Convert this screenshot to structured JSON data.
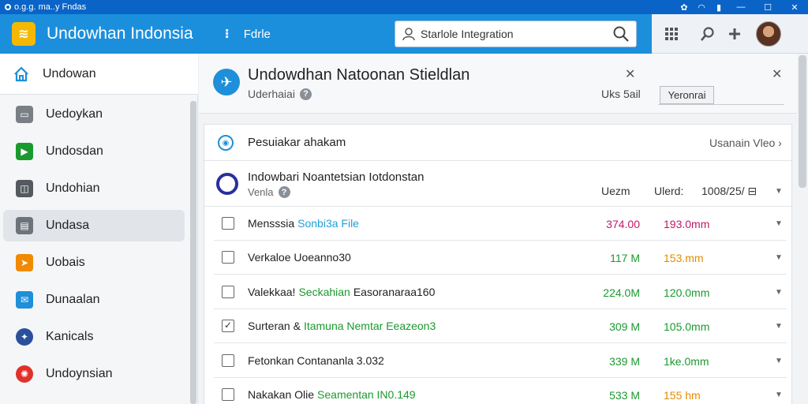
{
  "titlebar": {
    "title": "o.g.g. ma..y Fndas"
  },
  "header": {
    "app_title": "Undowhan Indonsia",
    "info_icon": "info-icon",
    "link": "Fdrle"
  },
  "search": {
    "value": "Starlole Integration"
  },
  "sidebar": {
    "items": [
      {
        "label": "Undowan",
        "icon": "home-icon"
      },
      {
        "label": "Uedoykan",
        "icon": "inbox-icon"
      },
      {
        "label": "Undosdan",
        "icon": "play-icon"
      },
      {
        "label": "Undohian",
        "icon": "folder-icon"
      },
      {
        "label": "Undasa",
        "icon": "window-icon"
      },
      {
        "label": "Uobais",
        "icon": "send-icon"
      },
      {
        "label": "Dunaalan",
        "icon": "mail-icon"
      },
      {
        "label": "Kanicals",
        "icon": "bird-icon"
      },
      {
        "label": "Undoynsian",
        "icon": "star-icon"
      }
    ]
  },
  "banner": {
    "title": "Undowdhan Natoonan Stieldlan",
    "subtitle": "Uderhaiai",
    "right_text": "Uks 5ail",
    "button": "Yeronrai"
  },
  "card": {
    "title": "Pesuiakar ahakam",
    "link": "Usanain Vleo ›",
    "group": {
      "title": "Indowbari Noantetsian Iotdonstan",
      "subtitle": "Venla",
      "col1": "Uezm",
      "col2": "Ulerd:",
      "col3": "1008/25/ ⊟"
    },
    "rows": [
      {
        "text": "Mensssia",
        "accent": "Sonbi3a File",
        "accent_color": "#1f9fd8",
        "value": "374.00",
        "value_color": "#c0186a",
        "value2": "193.0mm",
        "value2_color": "#c0186a",
        "checked": false
      },
      {
        "text": "Verkaloe Uoeanno30",
        "accent": "",
        "accent_color": "#222222",
        "value": "117 M",
        "value_color": "#1a9a2e",
        "value2": "153.mm",
        "value2_color": "#e58c00",
        "checked": false
      },
      {
        "text": "Valekkaa!",
        "accent": "Seckahian",
        "accent_color": "#1a9a2e",
        "tail": "Easoranaraa160",
        "value": "224.0M",
        "value_color": "#1a9a2e",
        "value2": "120.0mm",
        "value2_color": "#1a9a2e",
        "checked": false
      },
      {
        "text": "Surteran &",
        "accent": "Itamuna Nemtar Eeazeon3",
        "accent_color": "#1a9a2e",
        "value": "309 M",
        "value_color": "#1a9a2e",
        "value2": "105.0mm",
        "value2_color": "#1a9a2e",
        "checked": true
      },
      {
        "text": "Fetonkan Contananla 3.032",
        "accent": "",
        "accent_color": "#222222",
        "value": "339 M",
        "value_color": "#1a9a2e",
        "value2": "1ke.0mm",
        "value2_color": "#1a9a2e",
        "checked": false
      },
      {
        "text": "Nakakan Olie",
        "accent": "Seamentan IN0.149",
        "accent_color": "#1a9a2e",
        "value": "533 M",
        "value_color": "#1a9a2e",
        "value2": "155 hm",
        "value2_color": "#e58c00",
        "checked": false
      }
    ]
  }
}
